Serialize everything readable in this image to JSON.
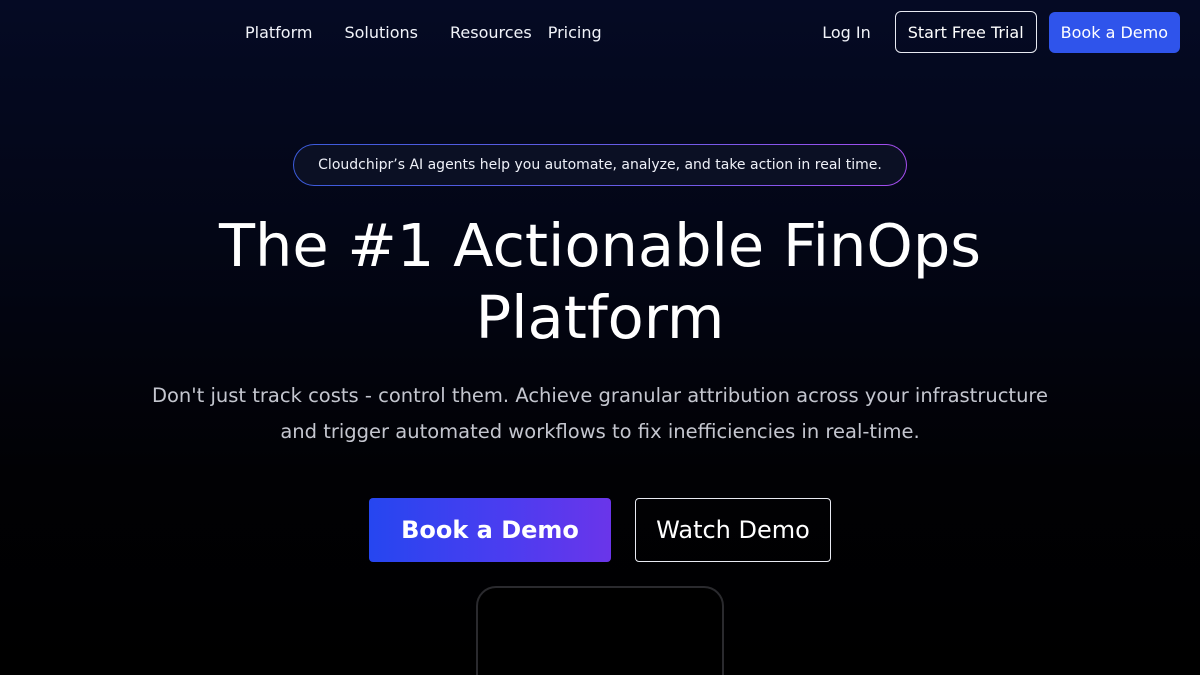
{
  "nav": {
    "links": [
      "Platform",
      "Solutions",
      "Resources",
      "Pricing"
    ],
    "login_label": "Log In",
    "trial_label": "Start Free Trial",
    "demo_label": "Book a Demo"
  },
  "hero": {
    "announcement": "Cloudchipr’s AI agents help you automate, analyze, and take action in real time.",
    "title_line1": "The #1 Actionable FinOps",
    "title_line2": "Platform",
    "subtitle_line1": "Don't just track costs - control them. Achieve granular attribution across your infrastructure",
    "subtitle_line2": "and trigger automated workflows to fix inefficiencies in real-time.",
    "primary_cta": "Book a Demo",
    "secondary_cta": "Watch Demo"
  },
  "colors": {
    "accent": "#2f54eb",
    "background_top": "#050a24",
    "background_bottom": "#000000",
    "gradient_end": "#6a35ea"
  }
}
